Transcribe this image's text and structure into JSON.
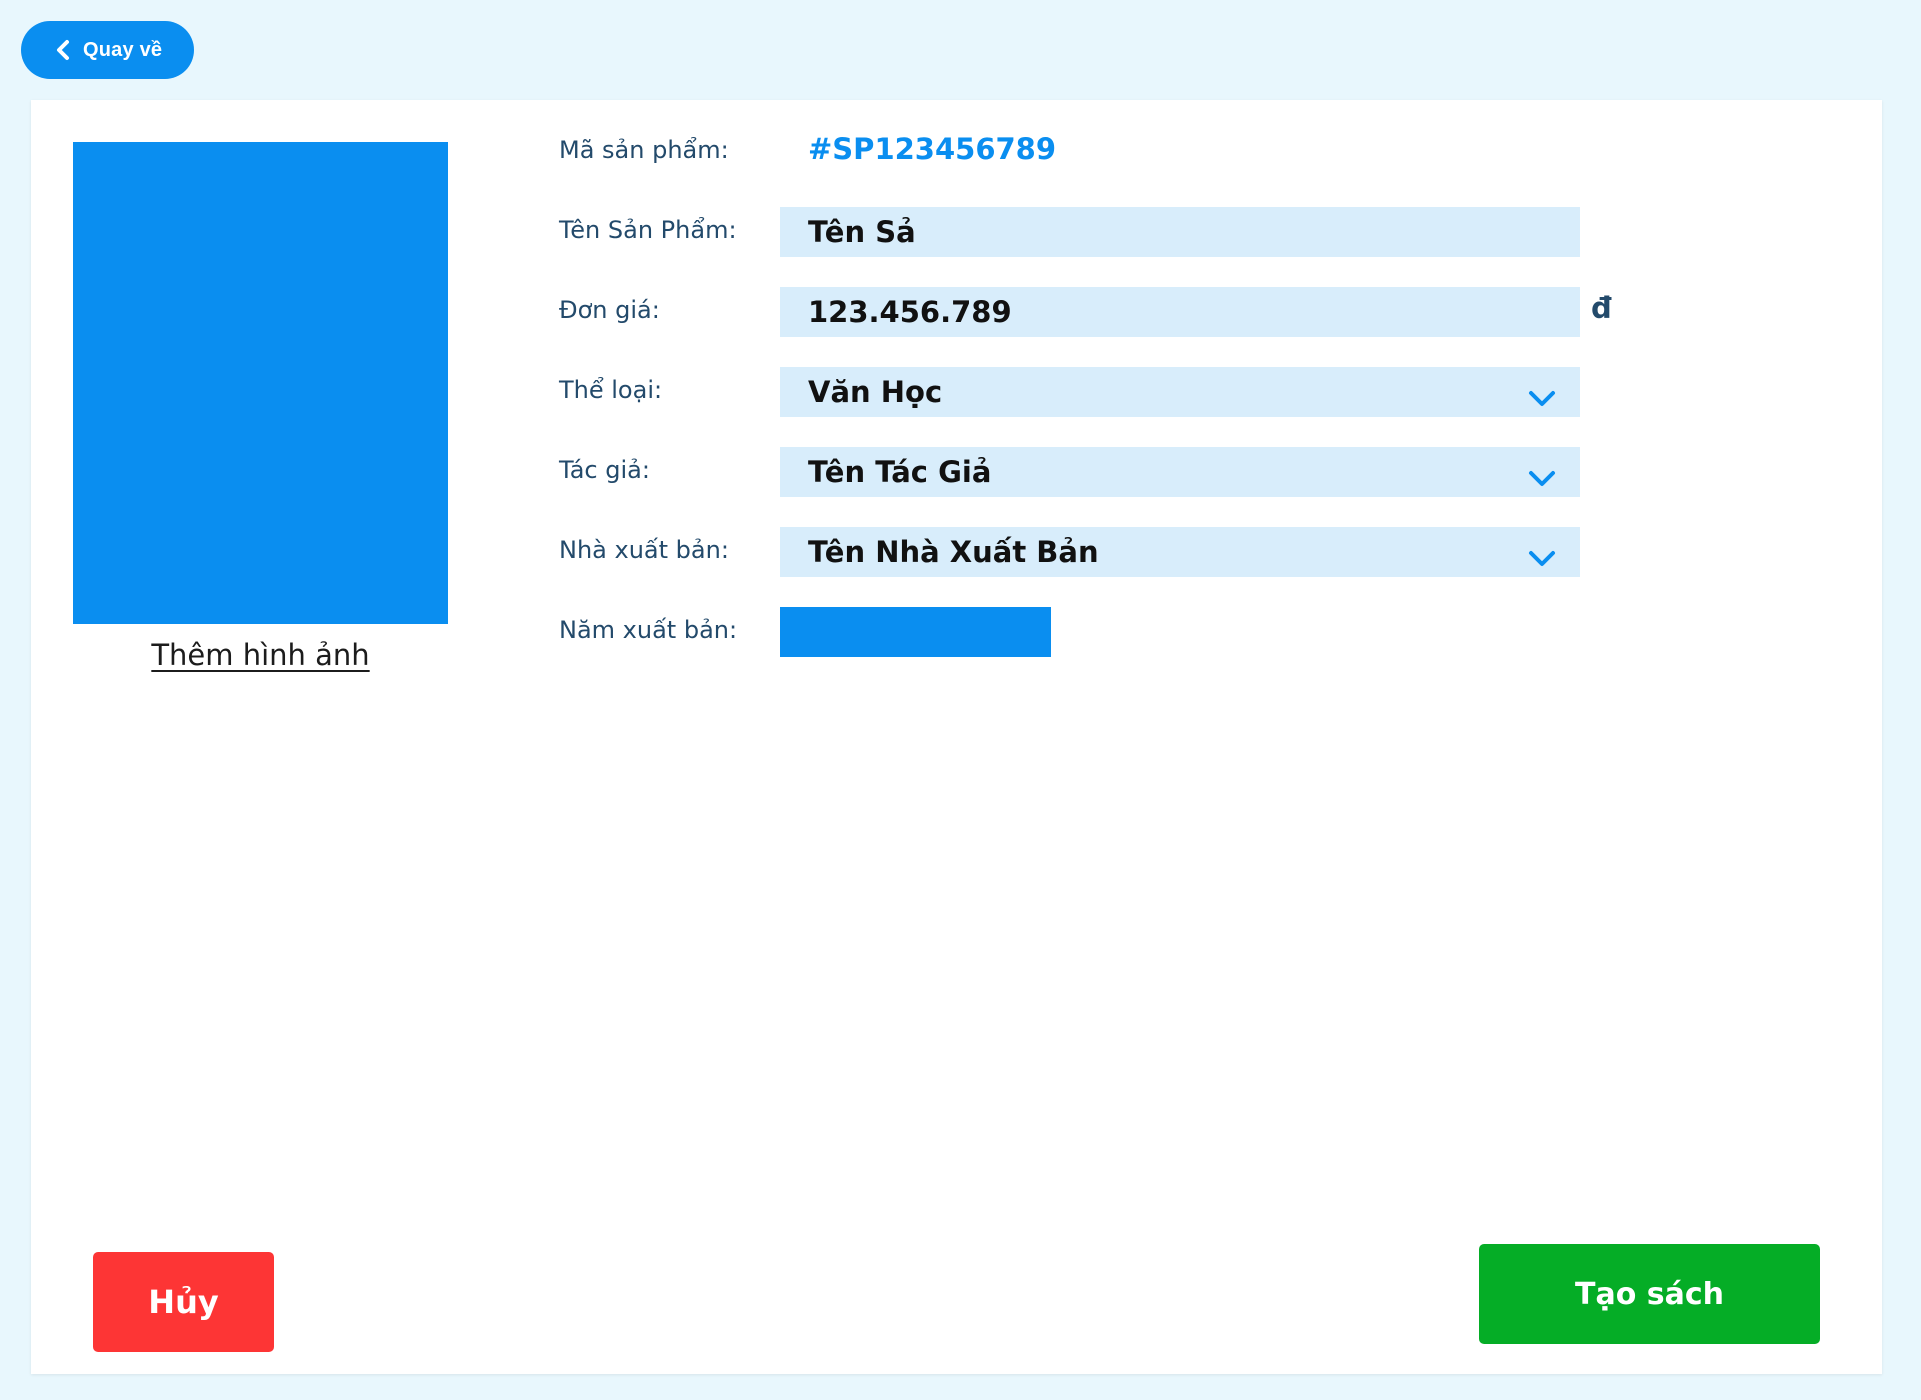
{
  "header": {
    "back_label": "Quay về"
  },
  "product_image": {
    "add_image_label": "Thêm hình ảnh"
  },
  "form": {
    "code": {
      "label": "Mã sản phẩm:",
      "value": "#SP123456789"
    },
    "name": {
      "label": "Tên Sản Phẩm:",
      "value": "Tên Sả"
    },
    "price": {
      "label": "Đơn giá:",
      "value": "123.456.789",
      "currency": "đ"
    },
    "category": {
      "label": "Thể loại:",
      "value": "Văn Học"
    },
    "author": {
      "label": "Tác giả:",
      "value": "Tên Tác Giả"
    },
    "publisher": {
      "label": "Nhà xuất bản:",
      "value": "Tên Nhà Xuất Bản"
    },
    "year": {
      "label": "Năm xuất bản:"
    }
  },
  "actions": {
    "cancel_label": "Hủy",
    "create_label": "Tạo sách"
  },
  "icons": {
    "back": "chevron-left-icon",
    "dropdown": "chevron-down-icon"
  },
  "colors": {
    "page_background": "#e8f7fd",
    "primary": "#0a8ef0",
    "input_background": "#d8edfb",
    "cancel": "#fd3535",
    "create": "#05ad26",
    "label_text": "#234a6b"
  }
}
